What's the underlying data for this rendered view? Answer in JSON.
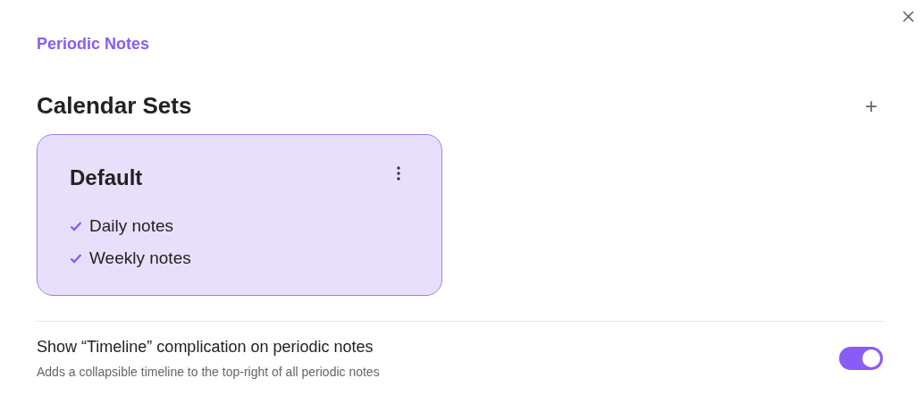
{
  "header": {
    "title": "Periodic Notes"
  },
  "section": {
    "title": "Calendar Sets",
    "add_label": "+"
  },
  "calendar_sets": [
    {
      "name": "Default",
      "items": [
        {
          "label": "Daily notes",
          "checked": true
        },
        {
          "label": "Weekly notes",
          "checked": true
        }
      ]
    }
  ],
  "settings": [
    {
      "name": "Show “Timeline” complication on periodic notes",
      "description": "Adds a collapsible timeline to the top-right of all periodic notes",
      "on": true
    }
  ]
}
